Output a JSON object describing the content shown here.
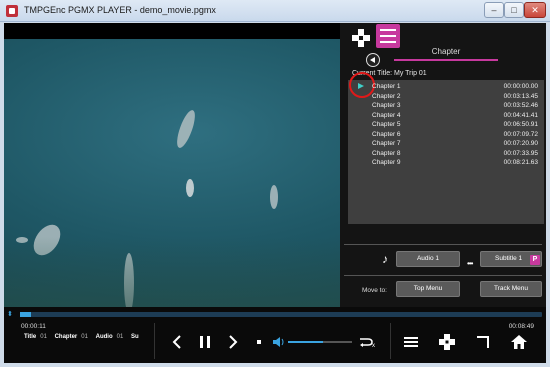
{
  "window": {
    "title": "TMPGEnc PGMX PLAYER - demo_movie.pgmx",
    "minimize": "–",
    "maximize": "□",
    "close": "✕"
  },
  "panel": {
    "tab": "Chapter",
    "current_title": "Current Title: My Trip 01",
    "chapters": [
      {
        "name": "Chapter 1",
        "time": "00:00:00.00"
      },
      {
        "name": "Chapter 2",
        "time": "00:03:13.45"
      },
      {
        "name": "Chapter 3",
        "time": "00:03:52.46"
      },
      {
        "name": "Chapter 4",
        "time": "00:04:41.41"
      },
      {
        "name": "Chapter 5",
        "time": "00:06:50.91"
      },
      {
        "name": "Chapter 6",
        "time": "00:07:09.72"
      },
      {
        "name": "Chapter 7",
        "time": "00:07:20.90"
      },
      {
        "name": "Chapter 8",
        "time": "00:07:33.95"
      },
      {
        "name": "Chapter 9",
        "time": "00:08:21.63"
      }
    ],
    "music_icon": "♪",
    "audio_button": "Audio 1",
    "subtitle_button": "Subtitle 1",
    "p_badge": "P",
    "move_to_label": "Move to:",
    "top_menu_button": "Top Menu",
    "track_menu_button": "Track Menu"
  },
  "playback": {
    "progress_fraction": 0.022,
    "volume_fraction": 0.55,
    "elapsed": "00:00:11",
    "total": "00:08:49",
    "info": {
      "title_label": "Title",
      "title_value": "01",
      "chapter_label": "Chapter",
      "chapter_value": "01",
      "audio_label": "Audio",
      "audio_value": "01",
      "subtitle_label": "Su"
    }
  },
  "colors": {
    "accent": "#c7399e",
    "seek": "#3aa3e0",
    "marker": "#3fd0c9"
  }
}
